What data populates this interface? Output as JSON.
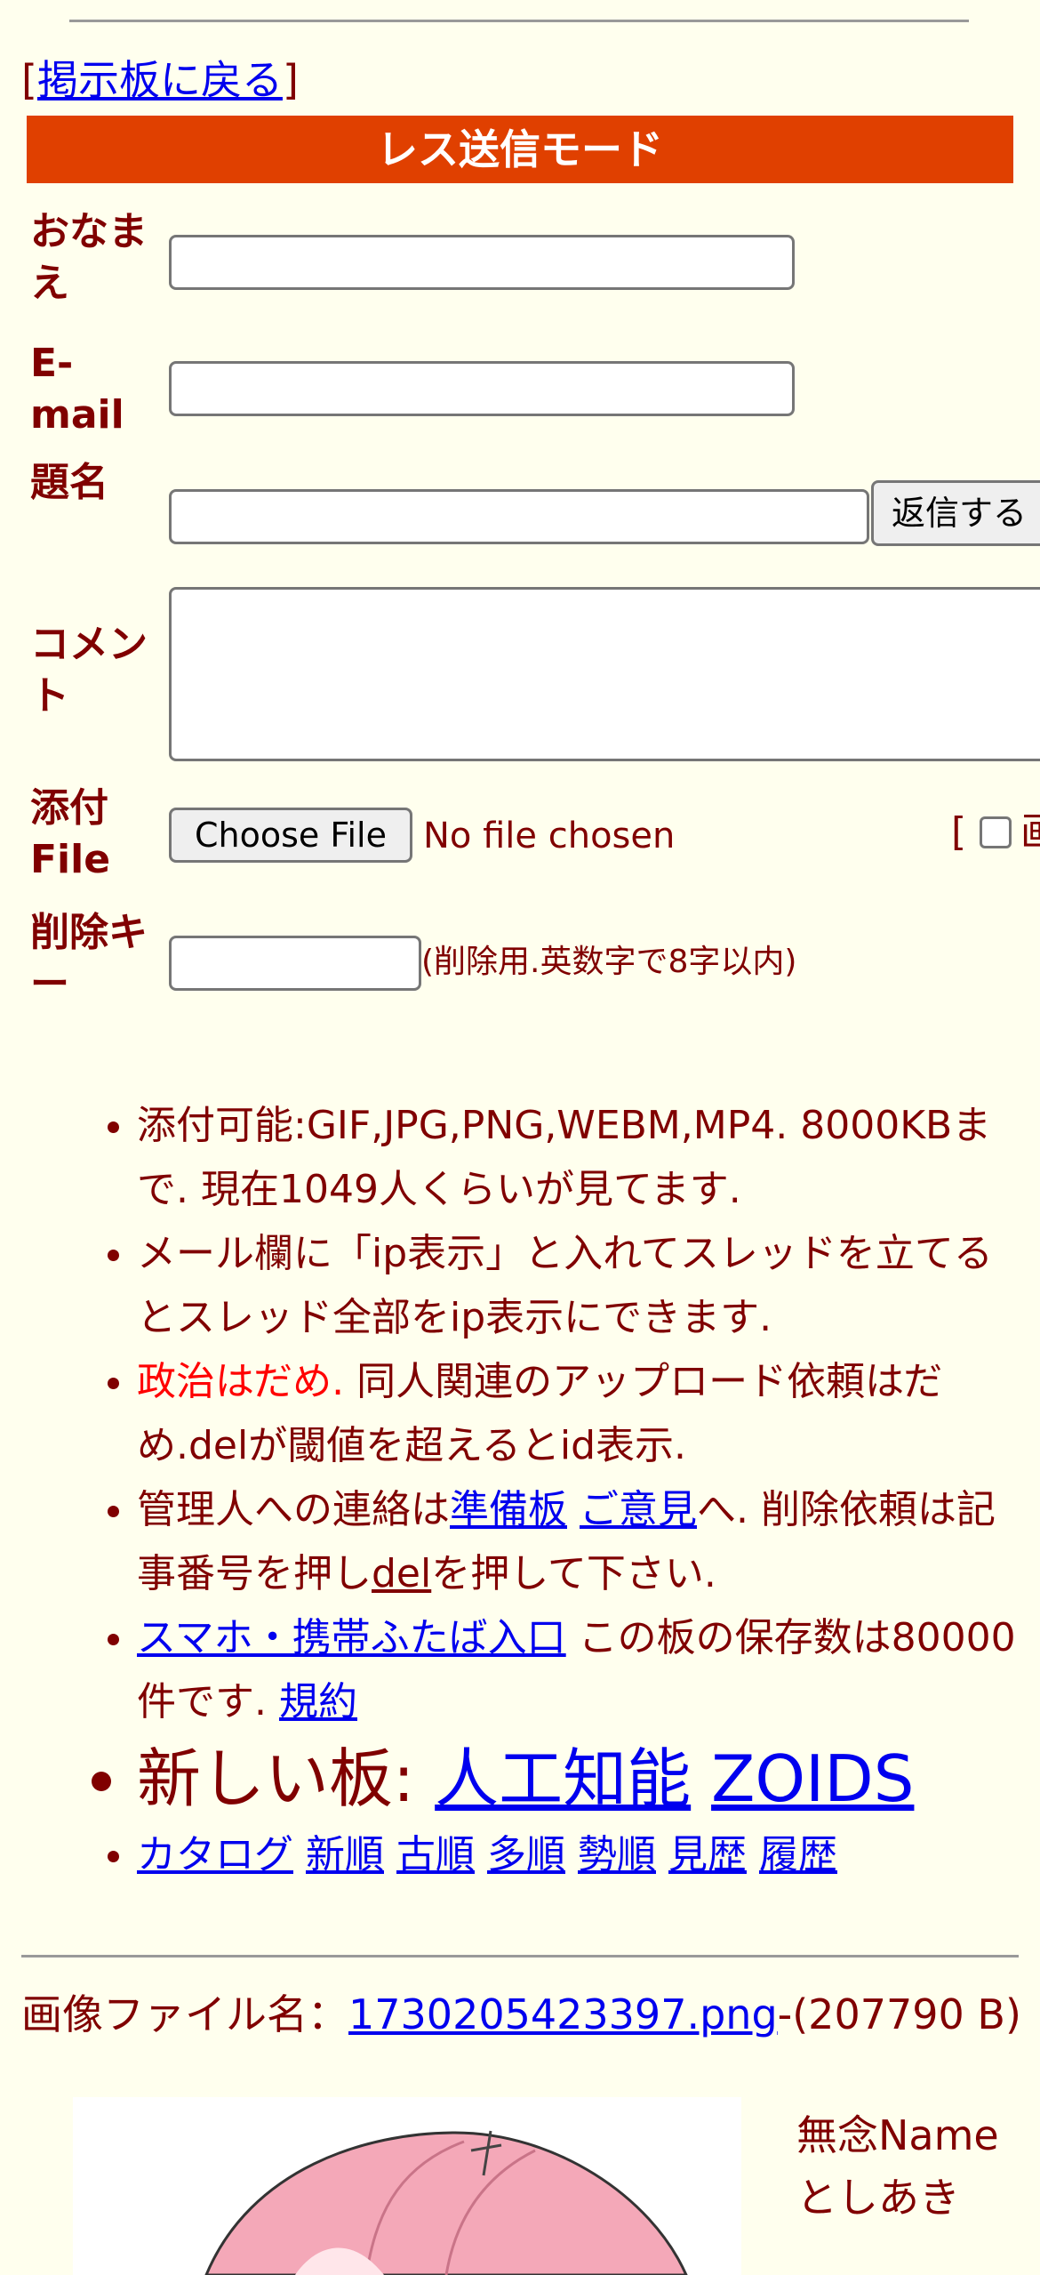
{
  "nav": {
    "back_link": "掲示板に戻る",
    "bracket_open": "[",
    "bracket_close": "]"
  },
  "form": {
    "mode_title": "レス送信モード",
    "name_label": "おなまえ",
    "email_label": "E-mail",
    "subject_label": "題名",
    "comment_label": "コメント",
    "file_label": "添付File",
    "delkey_label": "削除キー",
    "submit_label": "返信する",
    "choose_file_label": "Choose File",
    "no_file_text": "No file chosen",
    "image_option_bracket": "[",
    "image_option_label": "画",
    "delkey_hint": "(削除用.英数字で8字以内)",
    "name_value": "",
    "email_value": "",
    "subject_value": "",
    "comment_value": "",
    "delkey_value": ""
  },
  "notes": {
    "n1": "添付可能:GIF,JPG,PNG,WEBM,MP4. 8000KBまで. 現在1049人くらいが見てます.",
    "n2": "メール欄に「ip表示」と入れてスレッドを立てるとスレッド全部をip表示にできます.",
    "n3_red": "政治はだめ.",
    "n3_rest": " 同人関連のアップロード依頼はだめ.delが閾値を超えるとid表示.",
    "n4_pre": "管理人への連絡は",
    "n4_link1": "準備板",
    "n4_link2": "ご意見",
    "n4_mid": "へ. 削除依頼は記事番号を押し",
    "n4_link3": "del",
    "n4_post": "を押して下さい.",
    "n5_link1": "スマホ・携帯ふたば入口",
    "n5_mid": " この板の保存数は80000件です. ",
    "n5_link2": "規約",
    "n6_pre": "新しい板: ",
    "n6_link1": "人工知能",
    "n6_link2": "ZOIDS",
    "n7_links": [
      "カタログ",
      "新順",
      "古順",
      "多順",
      "勢順",
      "見歴",
      "履歴"
    ]
  },
  "post": {
    "file_label": "画像ファイル名：",
    "file_name": "1730205423397.png",
    "file_size": "-(207790 B)",
    "poster_name": "無念Name",
    "poster_handle": "としあき"
  }
}
